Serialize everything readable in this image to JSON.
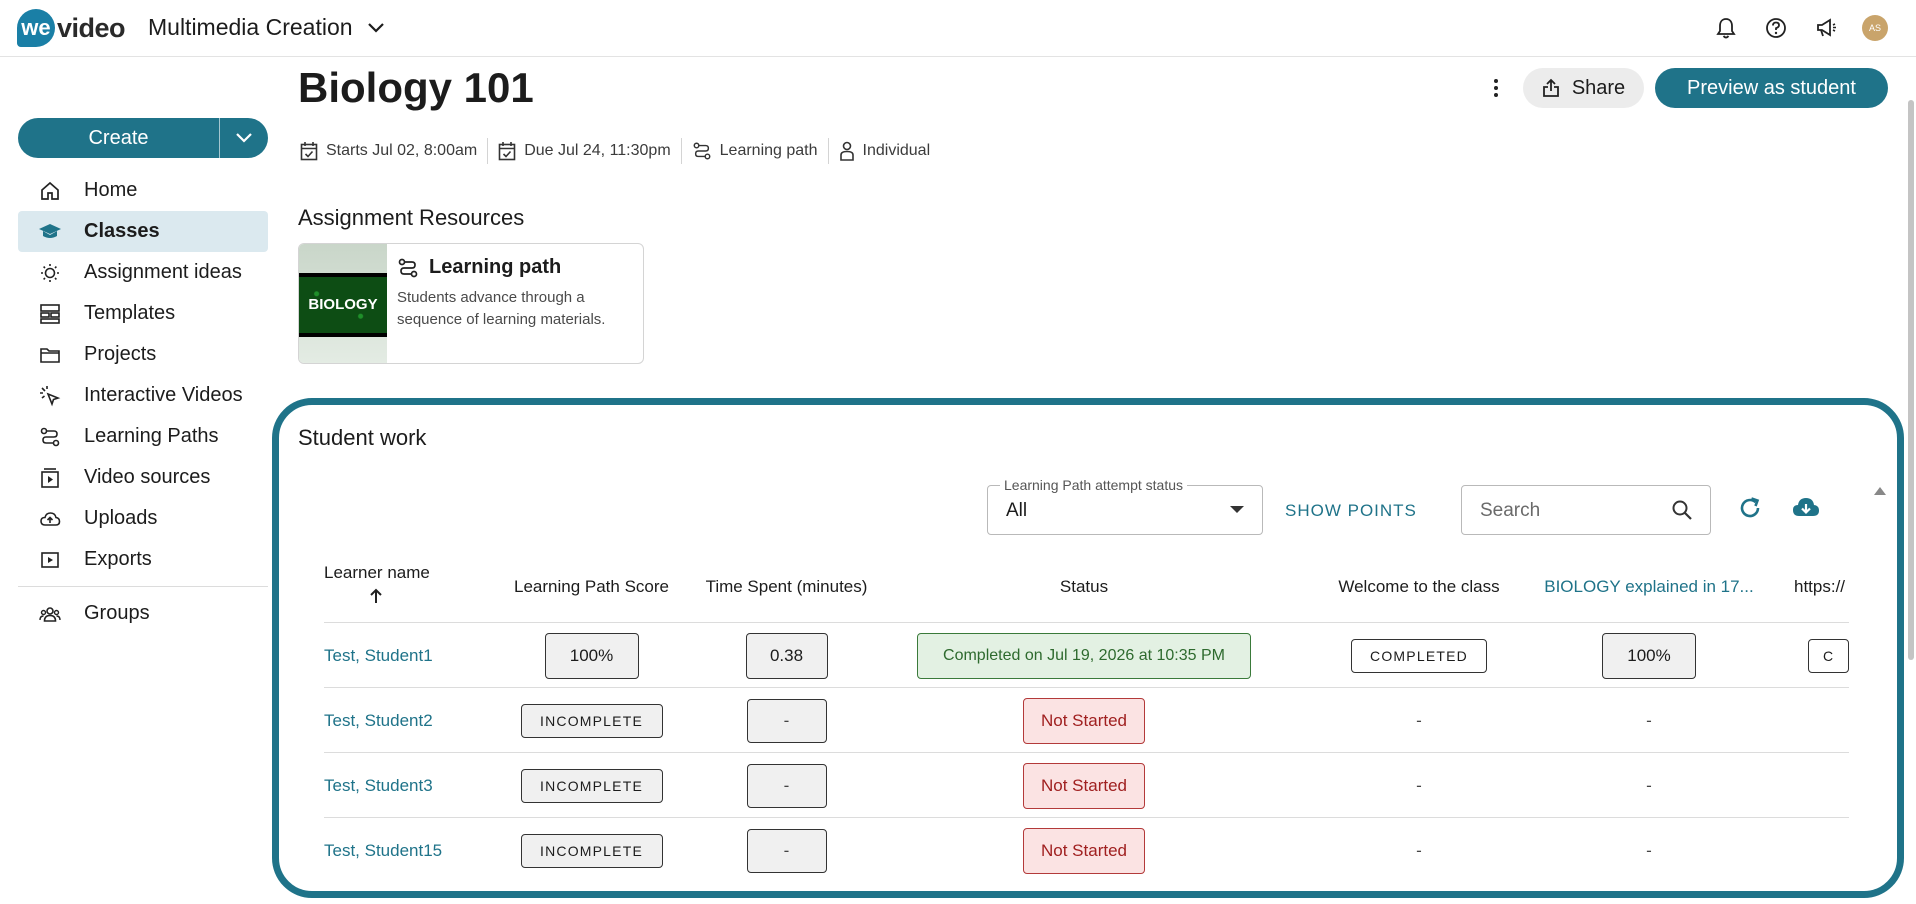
{
  "app": {
    "logo_we": "we",
    "logo_video": "video",
    "workspace": "Multimedia Creation",
    "avatar_initials": "AS"
  },
  "sidebar": {
    "create_label": "Create",
    "items": [
      {
        "label": "Home",
        "icon": "home-icon"
      },
      {
        "label": "Classes",
        "icon": "graduation-cap-icon",
        "active": true
      },
      {
        "label": "Assignment ideas",
        "icon": "lightbulb-icon"
      },
      {
        "label": "Templates",
        "icon": "templates-icon"
      },
      {
        "label": "Projects",
        "icon": "folder-icon"
      },
      {
        "label": "Interactive Videos",
        "icon": "cursor-click-icon"
      },
      {
        "label": "Learning Paths",
        "icon": "path-icon"
      },
      {
        "label": "Video sources",
        "icon": "video-source-icon"
      },
      {
        "label": "Uploads",
        "icon": "cloud-upload-icon"
      },
      {
        "label": "Exports",
        "icon": "export-icon"
      },
      {
        "label": "Groups",
        "icon": "groups-icon"
      }
    ]
  },
  "assignment": {
    "title": "Biology 101",
    "share_label": "Share",
    "preview_label": "Preview as student",
    "meta": {
      "starts": "Starts Jul 02, 8:00am",
      "due": "Due Jul 24, 11:30pm",
      "type": "Learning path",
      "mode": "Individual"
    }
  },
  "resources": {
    "heading": "Assignment Resources",
    "card": {
      "thumb_text": "BIOLOGY",
      "title": "Learning path",
      "description": "Students advance through a sequence of learning materials."
    }
  },
  "student_work": {
    "heading": "Student work",
    "filter_label": "Learning Path attempt status",
    "filter_value": "All",
    "show_points": "SHOW POINTS",
    "search_placeholder": "Search",
    "columns": {
      "name": "Learner name",
      "score": "Learning Path Score",
      "time": "Time Spent (minutes)",
      "status": "Status",
      "welcome": "Welcome to the class",
      "biology": "BIOLOGY explained in 17...",
      "url": "https://"
    },
    "rows": [
      {
        "name": "Test, Student1",
        "score": "100%",
        "time": "0.38",
        "status": "Completed on Jul 19, 2026 at 10:35 PM",
        "status_type": "completed",
        "welcome": "COMPLETED",
        "biology": "100%",
        "url": "C"
      },
      {
        "name": "Test, Student2",
        "score": "INCOMPLETE",
        "time": "-",
        "status": "Not Started",
        "status_type": "not-started",
        "welcome": "-",
        "biology": "-",
        "url": ""
      },
      {
        "name": "Test, Student3",
        "score": "INCOMPLETE",
        "time": "-",
        "status": "Not Started",
        "status_type": "not-started",
        "welcome": "-",
        "biology": "-",
        "url": ""
      },
      {
        "name": "Test, Student15",
        "score": "INCOMPLETE",
        "time": "-",
        "status": "Not Started",
        "status_type": "not-started",
        "welcome": "-",
        "biology": "-",
        "url": ""
      }
    ]
  },
  "colors": {
    "primary": "#1f7389",
    "active_bg": "#dbe9ef",
    "completed_bg": "#e3f1e3",
    "not_started_bg": "#fbe3e3"
  }
}
